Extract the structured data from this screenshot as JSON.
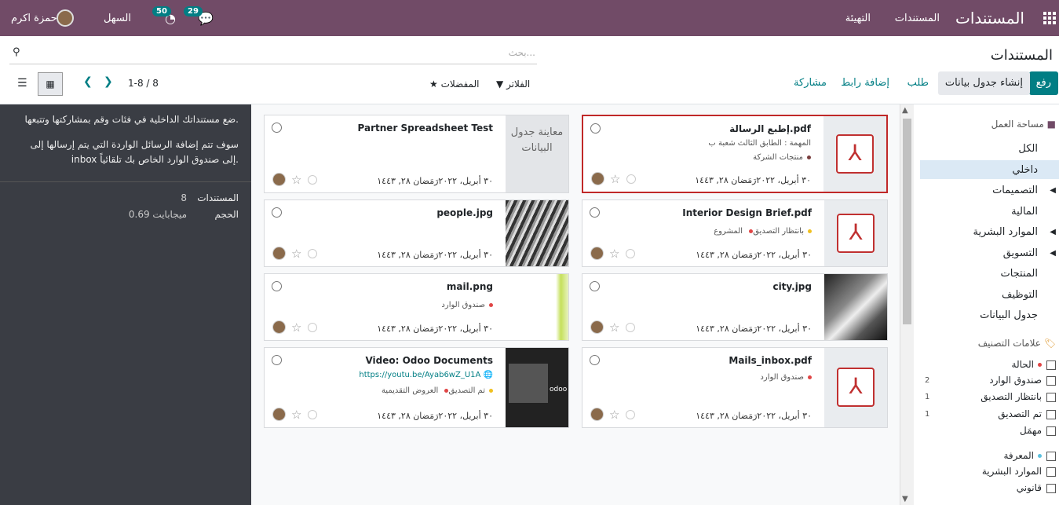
{
  "topbar": {
    "app_title": "المستندات",
    "menu_documents": "المستندات",
    "menu_config": "التهيئة",
    "user_name": "حمزة اكرم",
    "company": "السهل",
    "messages_count": "29",
    "activities_count": "50"
  },
  "control": {
    "breadcrumb": "المستندات",
    "search_placeholder": "بحث...",
    "upload": "رفع",
    "create_spreadsheet": "إنشاء جدول بيانات",
    "request": "طلب",
    "add_link": "إضافة رابط",
    "share": "مشاركة",
    "filters": "الفلاتر",
    "favorites": "المفضلات",
    "pager": "1-8 / 8"
  },
  "help": {
    "line1": "ضع مستنداتك الداخلية في فئات وقم بمشاركتها وتتبعها.",
    "line2": "سوف تتم إضافة الرسائل الواردة التي يتم إرسالها إلى inbox إلى صندوق الوارد الخاص بك تلقائياً.",
    "stats_documents_label": "المستندات",
    "stats_documents_value": "8",
    "stats_size_label": "الحجم",
    "stats_size_value": "0.69 ميجابايت"
  },
  "cards": [
    {
      "name": "إطبع الرسالة.pdf",
      "line1": "المهمة : الطابق الثالث شعبة ب",
      "tag1": "منتجات الشركة",
      "date": "٣٠ أبريل، ٢٠٢٢رَمَضان ٢٨, ١٤٤٣"
    },
    {
      "name": "Partner Spreadsheet Test",
      "thumb_label": "معاينة جدول البيانات",
      "date": "٣٠ أبريل، ٢٠٢٢رَمَضان ٢٨, ١٤٤٣"
    },
    {
      "name": "Interior Design Brief.pdf",
      "tag1": "بانتظار التصديق",
      "tag2": "المشروع",
      "date": "٣٠ أبريل، ٢٠٢٢رَمَضان ٢٨, ١٤٤٣"
    },
    {
      "name": "people.jpg",
      "date": "٣٠ أبريل، ٢٠٢٢رَمَضان ٢٨, ١٤٤٣"
    },
    {
      "name": "city.jpg",
      "date": "٣٠ أبريل، ٢٠٢٢رَمَضان ٢٨, ١٤٤٣"
    },
    {
      "name": "mail.png",
      "tag1": "صندوق الوارد",
      "date": "٣٠ أبريل، ٢٠٢٢رَمَضان ٢٨, ١٤٤٣"
    },
    {
      "name": "Mails_inbox.pdf",
      "tag1": "صندوق الوارد",
      "date": "٣٠ أبريل، ٢٠٢٢رَمَضان ٢٨, ١٤٤٣"
    },
    {
      "name": "Video: Odoo Documents",
      "url": "https://youtu.be/Ayab6wZ_U1A",
      "tag1": "تم التصديق",
      "tag2": "العروض التقديمية",
      "date": "٣٠ أبريل، ٢٠٢٢رَمَضان ٢٨, ١٤٤٣"
    }
  ],
  "sidebar": {
    "workspace": "مساحة العمل",
    "folders": [
      "الكل",
      "داخلي",
      "التصميمات",
      "المالية",
      "الموارد البشرية",
      "التسويق",
      "المنتجات",
      "التوظيف",
      "جدول البيانات"
    ],
    "tags_title": "علامات التصنيف",
    "tag_groups": [
      {
        "title": "الحالة",
        "items": [
          {
            "label": "صندوق الوارد",
            "count": "2"
          },
          {
            "label": "بانتظار التصديق",
            "count": "1"
          },
          {
            "label": "تم التصديق",
            "count": "1"
          },
          {
            "label": "مهمَل",
            "count": ""
          }
        ]
      },
      {
        "title": "المعرفة",
        "items": [
          {
            "label": "الموارد البشرية",
            "count": ""
          },
          {
            "label": "قانوني",
            "count": ""
          }
        ]
      }
    ]
  },
  "colors": {
    "brand": "#714b67",
    "accent": "#017e84",
    "pdf": "#c03030",
    "selected": "#dbe9f5"
  }
}
